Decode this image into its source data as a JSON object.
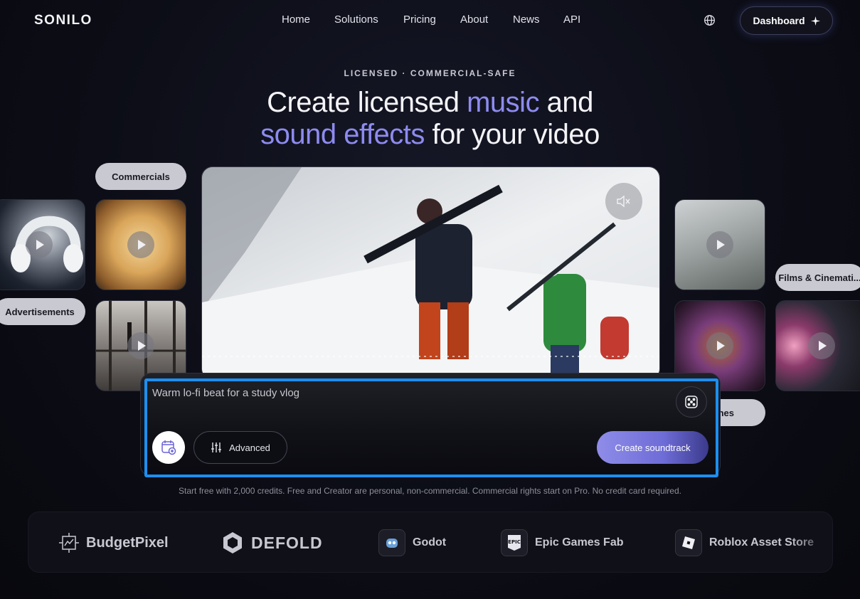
{
  "nav": {
    "logo": "SONILO",
    "links": [
      "Home",
      "Solutions",
      "Pricing",
      "About",
      "News",
      "API"
    ],
    "dashboard_label": "Dashboard"
  },
  "hero": {
    "eyebrow": "LICENSED · COMMERCIAL-SAFE",
    "headline_part1": "Create licensed ",
    "headline_accent1": "music",
    "headline_part2": " and",
    "headline_accent2": "sound effects",
    "headline_part3": " for your video"
  },
  "categories": {
    "commercials": "Commercials",
    "advertisements": "Advertisements",
    "films": "Films & Cinemati...",
    "games_partial": "nes"
  },
  "prompt": {
    "text": "Warm lo-fi beat for a study vlog",
    "advanced_label": "Advanced",
    "create_label": "Create soundtrack"
  },
  "fine_print": "Start free with 2,000 credits. Free and Creator are personal, non-commercial. Commercial rights start on Pro. No credit card required.",
  "partners": [
    "BudgetPixel",
    "DEFOLD",
    "Godot",
    "Epic Games Fab",
    "Roblox Asset Store"
  ],
  "colors": {
    "accent": "#8d8bf0",
    "focus": "#1c8ff0",
    "button_gradient_start": "#8f8de8"
  }
}
